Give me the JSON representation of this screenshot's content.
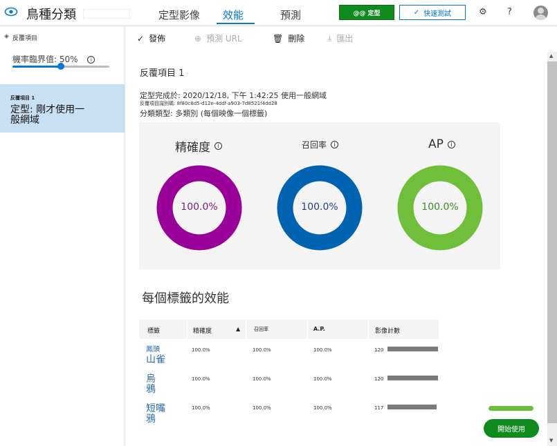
{
  "app": {
    "title": "鳥種分類",
    "nav_tabs": [
      {
        "label": "定型影像"
      },
      {
        "label": "效能"
      },
      {
        "label": "預測"
      }
    ],
    "train_label": "@@ 定型",
    "quick_test_label": "快速測試",
    "help_label": "?"
  },
  "sidebar": {
    "header": "反覆項目",
    "threshold_label": "機率臨界值: 50%",
    "threshold_value": 0.5,
    "iteration": {
      "small_label": "反覆項目 1",
      "big_label": "定型: 剛才使用一般網域"
    }
  },
  "toolbar": {
    "publish": "發佈",
    "prediction_url": "預測 URL",
    "delete": "刪除",
    "export": "匯出"
  },
  "main": {
    "title": "反覆項目 1",
    "meta_trained": "定型完成於: 2020/12/18, 下午 1:42:25 使用一般網域",
    "meta_id": "反覆項目識別碼: 8f80c8d5-d12e-4ddf-a903-7d8521f4dd28",
    "meta_type": "分類類型: 多類別 (每個映像一個標籤)"
  },
  "metrics": [
    {
      "label": "精確度",
      "value": "100.0%",
      "fraction": 1.0,
      "color": "#990099"
    },
    {
      "label": "召回率",
      "value": "100.0%",
      "fraction": 1.0,
      "color": "#0063b1"
    },
    {
      "label": "AP",
      "value": "100.0%",
      "fraction": 1.0,
      "color": "#6fbf3a"
    }
  ],
  "per_tag": {
    "title": "每個標籤的效能",
    "headers": [
      "標籤",
      "精確度",
      "召回率",
      "A.P.",
      "影像計數"
    ],
    "rows": [
      {
        "tag_small": "鳳頭",
        "tag_big": "山雀",
        "precision": "100.0%",
        "recall": "100.0%",
        "ap": "100.0%",
        "count": "120",
        "count_value": 120
      },
      {
        "tag_small": "",
        "tag_big": "烏鴉",
        "precision": "100.0%",
        "recall": "100.0%",
        "ap": "100.0%",
        "count": "120",
        "count_value": 120
      },
      {
        "tag_small": "",
        "tag_big": "短嘴鴉",
        "precision": "100.0%",
        "recall": "100.0%",
        "ap": "100.0%",
        "count": "117",
        "count_value": 117
      }
    ]
  },
  "footer": {
    "start_label": "開始使用"
  }
}
